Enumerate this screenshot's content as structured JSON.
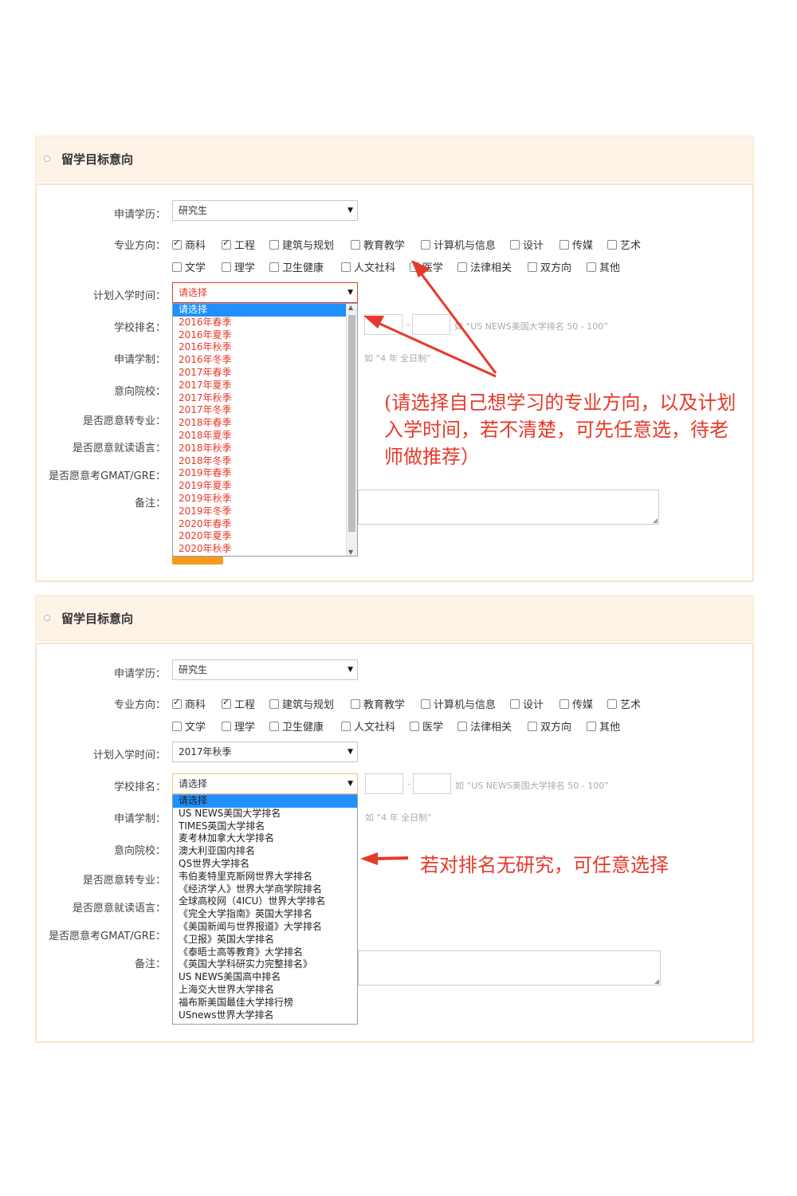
{
  "colors": {
    "header_bg": "#fdf3e7",
    "border": "#fbe4c8",
    "annotation": "#e53a2a",
    "dropdown_selected": "#1e90ff",
    "button": "#f39a1a"
  },
  "panel1": {
    "title": "留学目标意向",
    "labels": {
      "degree": "申请学历：",
      "major": "专业方向：",
      "start_time": "计划入学时间：",
      "ranking": "学校排名：",
      "duration": "申请学制：",
      "target_school": "意向院校：",
      "change_major": "是否愿意转专业：",
      "language": "是否愿意就读语言：",
      "gmat_gre": "是否愿意考GMAT/GRE：",
      "remarks": "备注："
    },
    "degree_value": "研究生",
    "majors_row1": [
      {
        "label": "商科",
        "checked": true
      },
      {
        "label": "工程",
        "checked": true
      },
      {
        "label": "建筑与规划",
        "checked": false
      },
      {
        "label": "教育教学",
        "checked": false
      },
      {
        "label": "计算机与信息",
        "checked": false
      },
      {
        "label": "设计",
        "checked": false
      },
      {
        "label": "传媒",
        "checked": false
      },
      {
        "label": "艺术",
        "checked": false
      }
    ],
    "majors_row2": [
      {
        "label": "文学",
        "checked": false
      },
      {
        "label": "理学",
        "checked": false
      },
      {
        "label": "卫生健康",
        "checked": false
      },
      {
        "label": "人文社科",
        "checked": false
      },
      {
        "label": "医学",
        "checked": false
      },
      {
        "label": "法律相关",
        "checked": false
      },
      {
        "label": "双方向",
        "checked": false
      },
      {
        "label": "其他",
        "checked": false
      }
    ],
    "start_time_value": "请选择",
    "start_time_options": [
      "请选择",
      "2016年春季",
      "2016年夏季",
      "2016年秋季",
      "2016年冬季",
      "2017年春季",
      "2017年夏季",
      "2017年秋季",
      "2017年冬季",
      "2018年春季",
      "2018年夏季",
      "2018年秋季",
      "2018年冬季",
      "2019年春季",
      "2019年夏季",
      "2019年秋季",
      "2019年冬季",
      "2020年春季",
      "2020年夏季",
      "2020年秋季"
    ],
    "ranking_hint": "如 “US NEWS美国大学排名 50 - 100”",
    "duration_hint": "如 “4 年 全日制”",
    "annotation": "(请选择自己想学习的专业方向，以及计划入学时间，若不清楚，可先任意选，待老师做推荐）"
  },
  "panel2": {
    "title": "留学目标意向",
    "degree_value": "研究生",
    "start_time_value": "2017年秋季",
    "ranking_value": "请选择",
    "ranking_options": [
      "请选择",
      "US NEWS美国大学排名",
      "TIMES英国大学排名",
      "麦考林加拿大大学排名",
      "澳大利亚国内排名",
      "QS世界大学排名",
      "韦伯麦特里克斯网世界大学排名",
      "《经济学人》世界大学商学院排名",
      "全球高校网（4ICU）世界大学排名",
      "《完全大学指南》英国大学排名",
      "《美国新闻与世界报道》大学排名",
      "《卫报》英国大学排名",
      "《泰晤士高等教育》大学排名",
      "《英国大学科研实力完整排名》",
      "US NEWS美国高中排名",
      "上海交大世界大学排名",
      "福布斯美国最佳大学排行榜",
      "USnews世界大学排名"
    ],
    "ranking_hint": "如 “US NEWS美国大学排名 50 - 100”",
    "duration_hint": "如 “4 年 全日制”",
    "annotation": "若对排名无研究，可任意选择"
  }
}
